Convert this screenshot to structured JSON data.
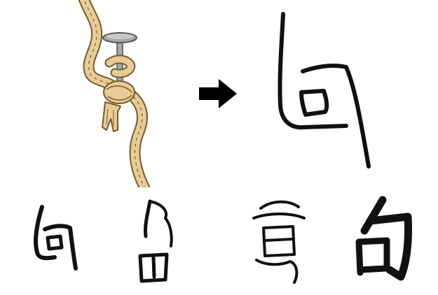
{
  "figure": {
    "origin_illustration": "rope-tied-to-nail",
    "pictograph": "early-form-of-句",
    "evolution_stages": [
      {
        "script": "oracle-bone"
      },
      {
        "script": "bronze"
      },
      {
        "script": "seal"
      },
      {
        "script": "regular",
        "character": "句"
      }
    ]
  },
  "colors": {
    "ink": "#111111",
    "rope_fill": "#e6cc96",
    "rope_stroke": "#7a5a2a",
    "nail_fill": "#a7a7a7",
    "nail_stroke": "#555555",
    "arrow": "#000000"
  },
  "icons": {
    "arrow": "right-arrow-icon"
  }
}
